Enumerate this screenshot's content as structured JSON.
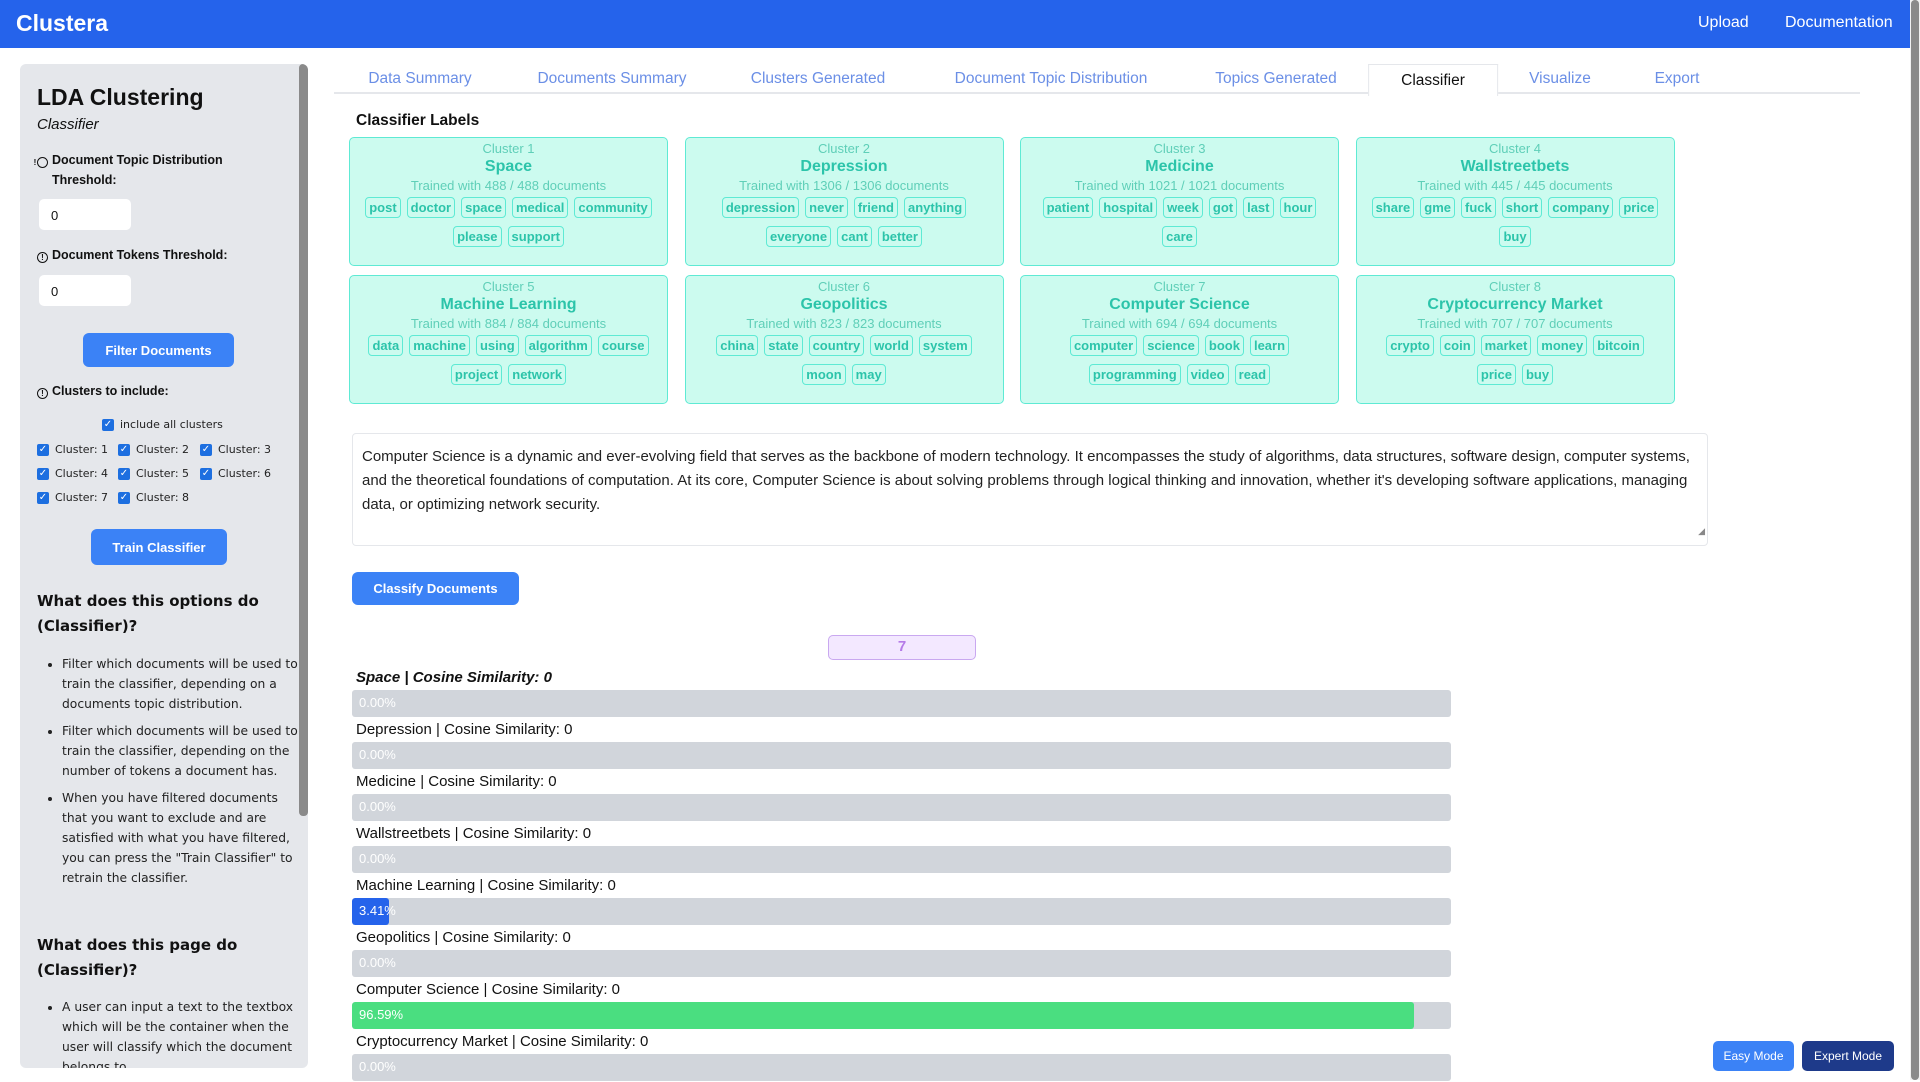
{
  "header": {
    "title": "Clustera",
    "nav": [
      "Upload",
      "Documentation"
    ]
  },
  "sidebar": {
    "title": "LDA Clustering",
    "subtitle": "Classifier",
    "topic_threshold_label": "Document Topic Distribution Threshold:",
    "topic_threshold_value": "0",
    "tokens_threshold_label": "Document Tokens Threshold:",
    "tokens_threshold_value": "0",
    "filter_button": "Filter Documents",
    "clusters_label": "Clusters to include:",
    "include_all": "include all clusters",
    "clusters": [
      "Cluster: 1",
      "Cluster: 2",
      "Cluster: 3",
      "Cluster: 4",
      "Cluster: 5",
      "Cluster: 6",
      "Cluster: 7",
      "Cluster: 8"
    ],
    "train_button": "Train Classifier",
    "options_heading": "What does this options do (Classifier)?",
    "options_bullets": [
      "Filter which documents will be used to train the classifier, depending on a documents topic distribution.",
      "Filter which documents will be used to train the classifier, depending on the number of tokens a document has.",
      "When you have filtered documents that you want to exclude and are satisfied with what you have filtered, you can press the \"Train Classifier\" to retrain the classifier."
    ],
    "page_heading": "What does this page do (Classifier)?",
    "page_bullets": [
      "A user can input a text to the textbox which will be the container when the user will classify which the document belongs to."
    ]
  },
  "tabs": [
    "Data Summary",
    "Documents Summary",
    "Clusters Generated",
    "Document Topic Distribution",
    "Topics Generated",
    "Classifier",
    "Visualize",
    "Export"
  ],
  "active_tab": "Classifier",
  "main": {
    "labels_heading": "Classifier Labels",
    "clusters": [
      {
        "id": "Cluster 1",
        "name": "Space",
        "trained": "Trained with 488 / 488 documents",
        "tags": [
          "post",
          "doctor",
          "space",
          "medical",
          "community",
          "please",
          "support"
        ]
      },
      {
        "id": "Cluster 2",
        "name": "Depression",
        "trained": "Trained with 1306 / 1306 documents",
        "tags": [
          "depression",
          "never",
          "friend",
          "anything",
          "everyone",
          "cant",
          "better"
        ]
      },
      {
        "id": "Cluster 3",
        "name": "Medicine",
        "trained": "Trained with 1021 / 1021 documents",
        "tags": [
          "patient",
          "hospital",
          "week",
          "got",
          "last",
          "hour",
          "care"
        ]
      },
      {
        "id": "Cluster 4",
        "name": "Wallstreetbets",
        "trained": "Trained with 445 / 445 documents",
        "tags": [
          "share",
          "gme",
          "fuck",
          "short",
          "company",
          "price",
          "buy"
        ]
      },
      {
        "id": "Cluster 5",
        "name": "Machine Learning",
        "trained": "Trained with 884 / 884 documents",
        "tags": [
          "data",
          "machine",
          "using",
          "algorithm",
          "course",
          "project",
          "network"
        ]
      },
      {
        "id": "Cluster 6",
        "name": "Geopolitics",
        "trained": "Trained with 823 / 823 documents",
        "tags": [
          "china",
          "state",
          "country",
          "world",
          "system",
          "moon",
          "may"
        ]
      },
      {
        "id": "Cluster 7",
        "name": "Computer Science",
        "trained": "Trained with 694 / 694 documents",
        "tags": [
          "computer",
          "science",
          "book",
          "learn",
          "programming",
          "video",
          "read"
        ]
      },
      {
        "id": "Cluster 8",
        "name": "Cryptocurrency Market",
        "trained": "Trained with 707 / 707 documents",
        "tags": [
          "crypto",
          "coin",
          "market",
          "money",
          "bitcoin",
          "price",
          "buy"
        ]
      }
    ],
    "input_text": "Computer Science is a dynamic and ever-evolving field that serves as the backbone of modern technology. It encompasses the study of algorithms, data structures, software design, computer systems, and the theoretical foundations of computation. At its core, Computer Science is about solving problems through logical thinking and innovation, whether it's developing software applications, managing data, or optimizing network security.",
    "classify_button": "Classify Documents",
    "predicted_cluster": "7",
    "results": [
      {
        "label": "Space | Cosine Similarity: 0",
        "percent": 0,
        "pct_text": "0.00%",
        "bold": true
      },
      {
        "label": "Depression | Cosine Similarity: 0",
        "percent": 0,
        "pct_text": "0.00%"
      },
      {
        "label": "Medicine | Cosine Similarity: 0",
        "percent": 0,
        "pct_text": "0.00%"
      },
      {
        "label": "Wallstreetbets | Cosine Similarity: 0",
        "percent": 0,
        "pct_text": "0.00%"
      },
      {
        "label": "Machine Learning | Cosine Similarity: 0",
        "percent": 3.41,
        "pct_text": "3.41%",
        "color": "#2563eb"
      },
      {
        "label": "Geopolitics | Cosine Similarity: 0",
        "percent": 0,
        "pct_text": "0.00%"
      },
      {
        "label": "Computer Science | Cosine Similarity: 0",
        "percent": 96.59,
        "pct_text": "96.59%",
        "color": "#4ade80"
      },
      {
        "label": "Cryptocurrency Market | Cosine Similarity: 0",
        "percent": 0,
        "pct_text": "0.00%"
      }
    ]
  },
  "modes": {
    "easy": "Easy Mode",
    "expert": "Expert Mode"
  }
}
